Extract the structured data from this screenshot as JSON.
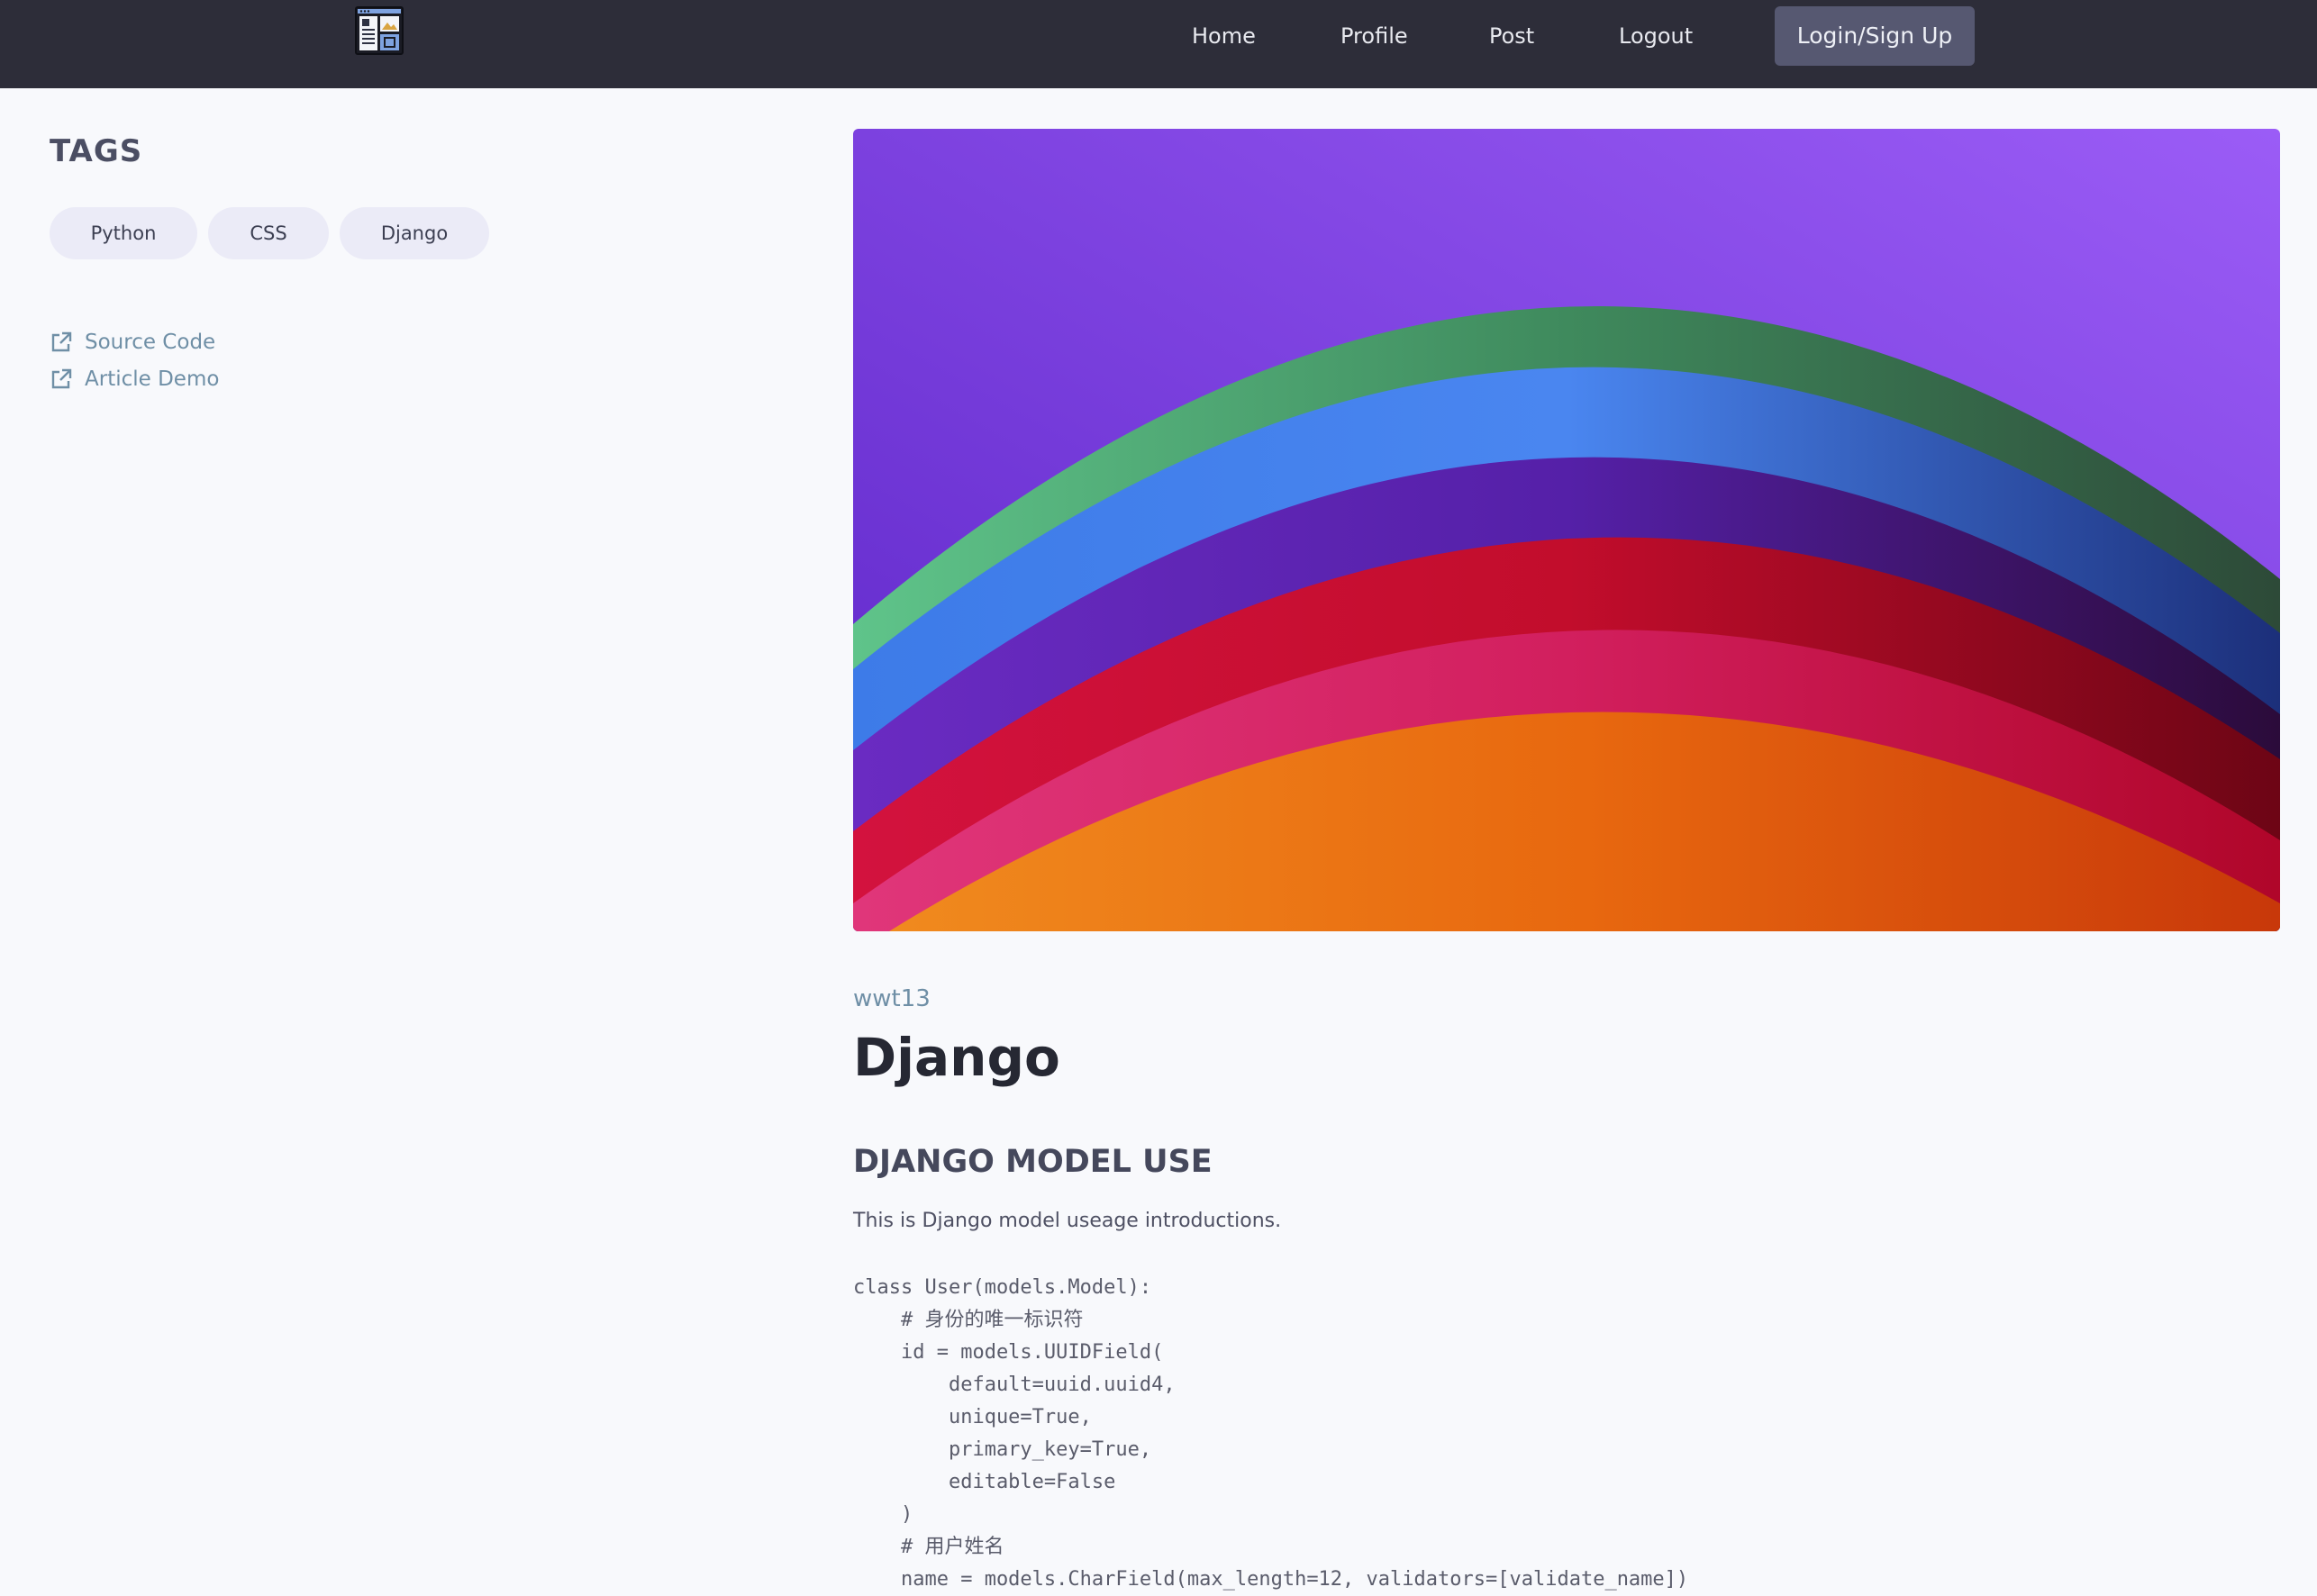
{
  "header": {
    "nav": {
      "home": "Home",
      "profile": "Profile",
      "post": "Post",
      "logout": "Logout",
      "login": "Login/Sign Up"
    },
    "logo_icon": "newspaper-layout-icon"
  },
  "sidebar": {
    "tags_heading": "TAGS",
    "tags": [
      "Python",
      "CSS",
      "Django"
    ],
    "links": [
      {
        "label": "Source Code",
        "icon": "external-link-icon"
      },
      {
        "label": "Article Demo",
        "icon": "external-link-icon"
      }
    ]
  },
  "article": {
    "hero_image": "rainbow-paper-arcs-image",
    "author": "wwt13",
    "title": "Django",
    "subheading": "DJANGO MODEL USE",
    "intro": "This is Django model useage introductions.",
    "code_lines": [
      "class User(models.Model):",
      "    # 身份的唯一标识符",
      "    id = models.UUIDField(",
      "        default=uuid.uuid4,",
      "        unique=True,",
      "        primary_key=True,",
      "        editable=False",
      "    )",
      "    # 用户姓名",
      "    name = models.CharField(max_length=12, validators=[validate_name])"
    ]
  },
  "colors": {
    "header_bg": "#2d2d39",
    "page_bg": "#f8f9fc",
    "tag_bg": "#ebebf7",
    "link": "#6f8fa6",
    "login_button_bg": "#565871"
  }
}
